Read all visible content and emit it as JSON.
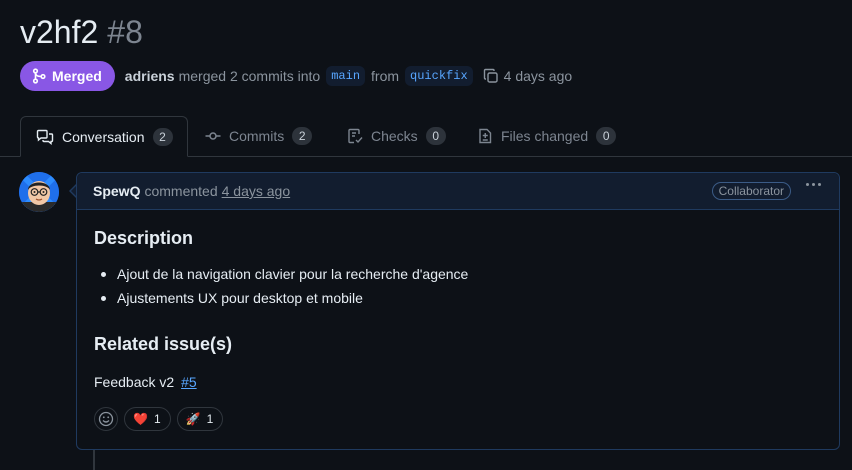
{
  "pr": {
    "title": "v2hf2",
    "number": "#8",
    "state": "Merged",
    "author": "adriens",
    "merge_text": "merged 2 commits into",
    "base_branch": "main",
    "from_text": "from",
    "head_branch": "quickfix",
    "time": "4 days ago"
  },
  "tabs": [
    {
      "label": "Conversation",
      "count": "2",
      "icon": "comment-discussion-icon"
    },
    {
      "label": "Commits",
      "count": "2",
      "icon": "commit-icon"
    },
    {
      "label": "Checks",
      "count": "0",
      "icon": "checklist-icon"
    },
    {
      "label": "Files changed",
      "count": "0",
      "icon": "file-diff-icon"
    }
  ],
  "comment": {
    "author": "SpewQ",
    "action": "commented",
    "time": "4 days ago",
    "role": "Collaborator",
    "heading1": "Description",
    "bullets": [
      "Ajout de la navigation clavier pour la recherche d'agence",
      "Ajustements UX pour desktop et mobile"
    ],
    "heading2": "Related issue(s)",
    "feedback_text": "Feedback v2",
    "issue_link": "#5",
    "reactions": [
      {
        "emoji": "❤️",
        "icon": "heart-emoji",
        "count": "1"
      },
      {
        "emoji": "🚀",
        "icon": "rocket-emoji",
        "count": "1"
      }
    ]
  },
  "colors": {
    "background": "#0d1117",
    "merged": "#8957e5",
    "link": "#58a6ff",
    "comment_border": "#1f3a5f"
  }
}
